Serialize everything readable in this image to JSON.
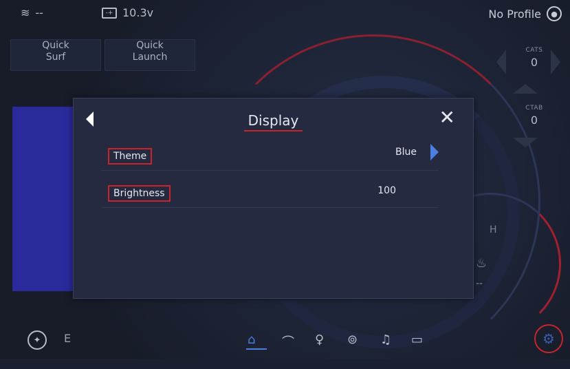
{
  "topbar": {
    "water_value": "--",
    "battery_value": "10.3v",
    "profile_label": "No Profile"
  },
  "quick_buttons": [
    {
      "line1": "Quick",
      "line2": "Surf"
    },
    {
      "line1": "Quick",
      "line2": "Launch"
    }
  ],
  "side_controls": {
    "cats": {
      "label": "CATS",
      "value": "0"
    },
    "ctab": {
      "label": "CTAB",
      "value": "0"
    }
  },
  "gauge": {
    "h_label": "H",
    "temp_value": "--"
  },
  "modal": {
    "title": "Display",
    "close_glyph": "✕",
    "rows": [
      {
        "label": "Theme",
        "value": "Blue"
      },
      {
        "label": "Brightness",
        "value": "100"
      }
    ]
  },
  "bottombar": {
    "direction": "E",
    "nav_icons": [
      "home-icon",
      "wave-icon",
      "light-bulb-icon",
      "location-pin-icon",
      "music-note-icon",
      "screen-icon"
    ],
    "active": "home-icon"
  },
  "colors": {
    "accent_blue": "#4a7fe0",
    "accent_red": "#c8252b",
    "panel_blue": "#2a2a9c"
  }
}
